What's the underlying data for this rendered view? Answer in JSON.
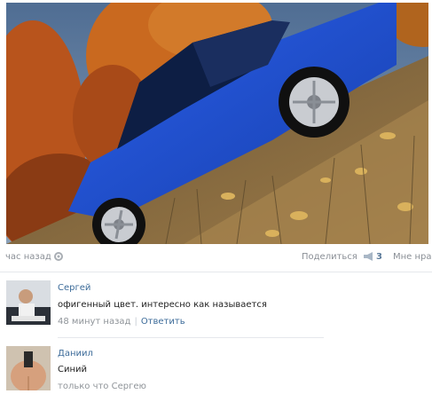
{
  "post": {
    "time": "час назад",
    "share_label": "Поделиться",
    "share_count": "3",
    "like_label": "Мне нрав"
  },
  "comments": [
    {
      "author": "Сергей",
      "text": "офигенный цвет. интересно как называется",
      "time": "48 минут назад",
      "reply_label": "Ответить"
    },
    {
      "author": "Даниил",
      "text": "Синий",
      "time": "только что Сергею"
    }
  ],
  "colors": {
    "car": "#1f4fd1",
    "link": "#3c6b99",
    "muted": "#8f9499"
  },
  "icons": [
    "settings-icon",
    "megaphone-icon"
  ]
}
